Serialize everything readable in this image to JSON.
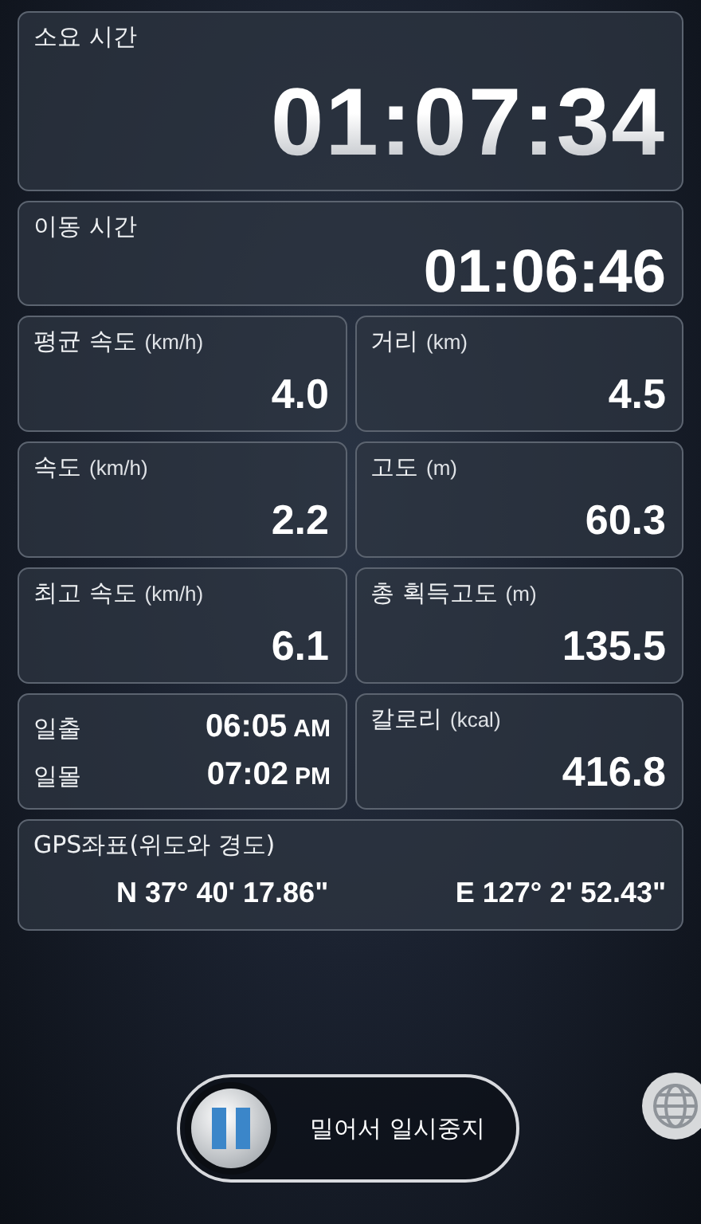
{
  "elapsed_time": {
    "label": "소요 시간",
    "value": "01:07:34"
  },
  "moving_time": {
    "label": "이동 시간",
    "value": "01:06:46"
  },
  "stats": [
    {
      "label": "평균 속도",
      "unit": "(km/h)",
      "value": "4.0"
    },
    {
      "label": "거리",
      "unit": "(km)",
      "value": "4.5"
    },
    {
      "label": "속도",
      "unit": "(km/h)",
      "value": "2.2"
    },
    {
      "label": "고도",
      "unit": "(m)",
      "value": "60.3"
    },
    {
      "label": "최고 속도",
      "unit": "(km/h)",
      "value": "6.1"
    },
    {
      "label": "총 획득고도",
      "unit": "(m)",
      "value": "135.5"
    }
  ],
  "sun": [
    {
      "label": "일출",
      "time": "06:05",
      "period": "AM"
    },
    {
      "label": "일몰",
      "time": "07:02",
      "period": "PM"
    }
  ],
  "calories": {
    "label": "칼로리",
    "unit": "(kcal)",
    "value": "416.8"
  },
  "gps": {
    "label": "GPS좌표(위도와 경도)",
    "latitude": "N 37° 40' 17.86\"",
    "longitude": "E 127° 2' 52.43\""
  },
  "pause_slider": {
    "label": "밀어서 일시중지",
    "level": 0
  }
}
